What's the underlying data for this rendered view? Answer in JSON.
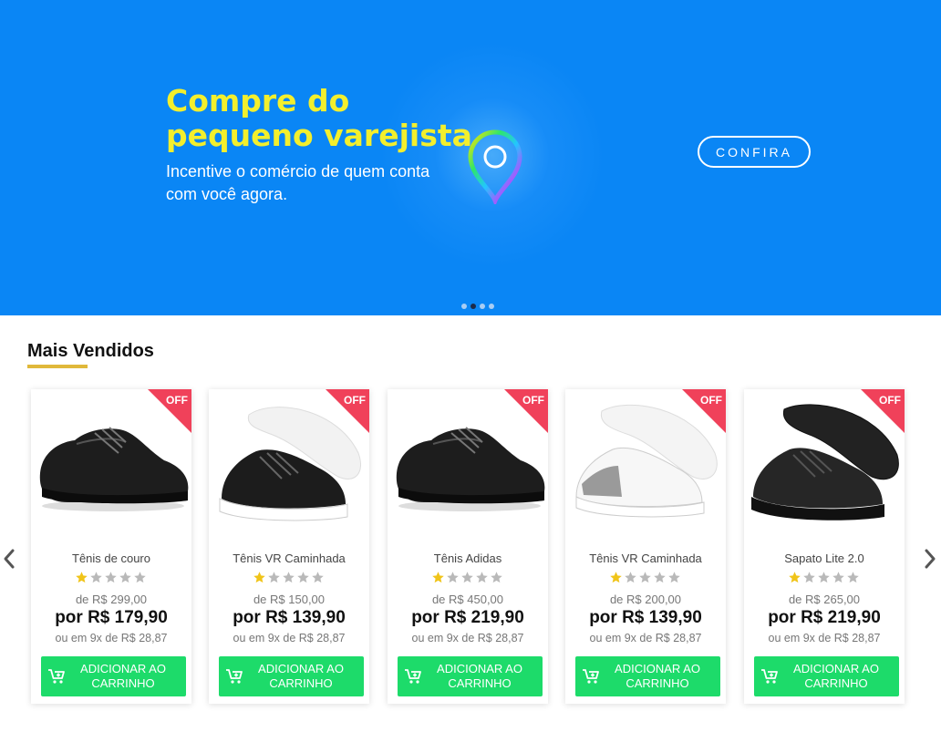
{
  "banner": {
    "title": "Compre do pequeno varejista",
    "subtitle": "Incentive o comércio de quem conta com você agora.",
    "cta_label": "CONFIRA",
    "slide_count": 4,
    "active_slide": 2
  },
  "section": {
    "title": "Mais Vendidos"
  },
  "colors": {
    "banner_bg": "#0a86f5",
    "title_yellow": "#f3ef2d",
    "off_ribbon": "#f0415a",
    "add_button": "#1ddb6a",
    "star": "#f0c419"
  },
  "products": [
    {
      "name": "Tênis de couro",
      "badge": "OFF",
      "rating": 1,
      "old_price": "de  R$ 299,00",
      "price": "por R$ 179,90",
      "installments": "ou em 9x de R$ 28,87",
      "button": "ADICIONAR AO CARRINHO",
      "image": "black-leather-shoe"
    },
    {
      "name": "Tênis VR Caminhada",
      "badge": "OFF",
      "rating": 1,
      "old_price": "de  R$ 150,00",
      "price": "por R$ 139,90",
      "installments": "ou em 9x de R$ 28,87",
      "button": "ADICIONAR AO CARRINHO",
      "image": "black-sneaker-white-sole"
    },
    {
      "name": "Tênis Adidas",
      "badge": "OFF",
      "rating": 1,
      "old_price": "de  R$ 450,00",
      "price": "por R$ 219,90",
      "installments": "ou em 9x de R$ 28,87",
      "button": "ADICIONAR AO CARRINHO",
      "image": "black-leather-shoe"
    },
    {
      "name": "Tênis VR Caminhada",
      "badge": "OFF",
      "rating": 1,
      "old_price": "de  R$ 200,00",
      "price": "por R$ 139,90",
      "installments": "ou em 9x de R$ 28,87",
      "button": "ADICIONAR AO CARRINHO",
      "image": "white-sneaker"
    },
    {
      "name": "Sapato Lite 2.0",
      "badge": "OFF",
      "rating": 1,
      "old_price": "de  R$ 265,00",
      "price": "por R$ 219,90",
      "installments": "ou em 9x de R$ 28,87",
      "button": "ADICIONAR AO CARRINHO",
      "image": "all-black-sneaker"
    }
  ]
}
